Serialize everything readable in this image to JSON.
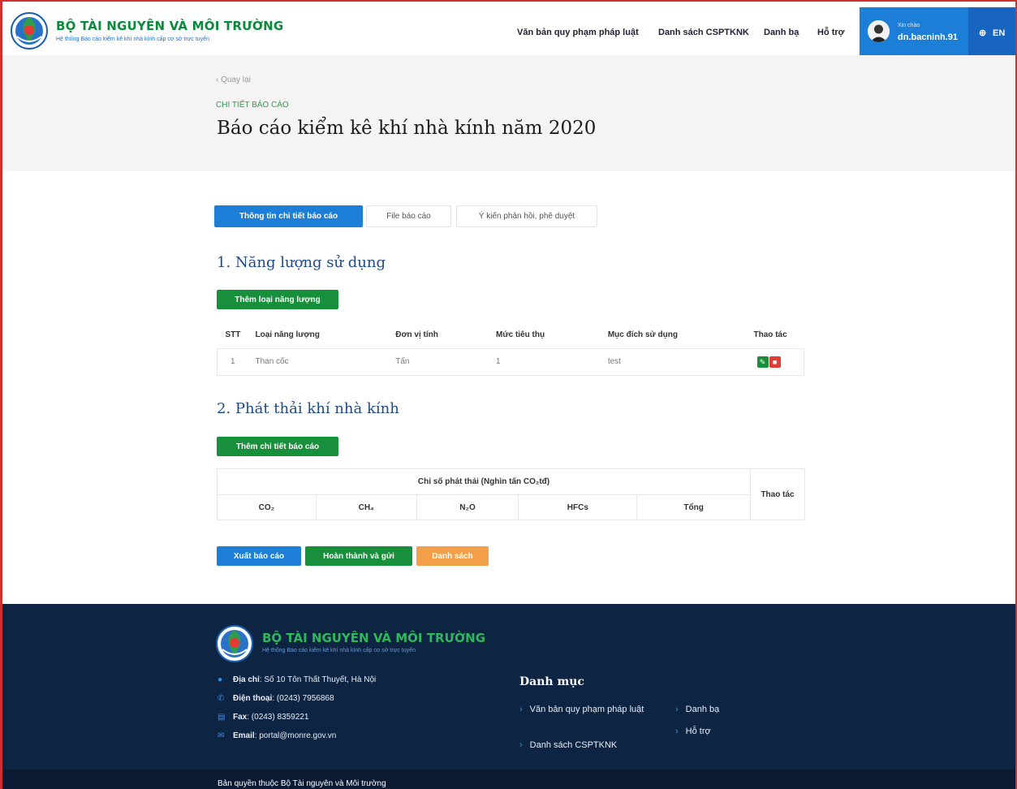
{
  "header": {
    "brand_title": "BỘ TÀI NGUYÊN VÀ MÔI TRƯỜNG",
    "brand_subtitle": "Hệ thống Báo cáo kiểm kê khí nhà kính cấp cơ sở trực tuyến",
    "nav": [
      "Văn bản quy phạm pháp luật",
      "Danh sách CSPTKNK",
      "Danh bạ",
      "Hỗ trợ"
    ],
    "greeting": "Xin chào",
    "username": "dn.bacninh.91",
    "language": "EN",
    "accent": "#1c7ed6"
  },
  "hero": {
    "back": "‹ Quay lại",
    "eyebrow": "CHI TIẾT BÁO CÁO",
    "title": "Báo cáo kiểm kê khí nhà kính năm 2020"
  },
  "tabs": [
    "Thông tin chi tiết báo cáo",
    "File báo cáo",
    "Ý kiến phản hồi, phê duyệt"
  ],
  "section1": {
    "title": "1. Năng lượng sử dụng",
    "add_button": "Thêm loại năng lượng",
    "columns": [
      "STT",
      "Loại năng lượng",
      "Đơn vị tính",
      "Mức tiêu thụ",
      "Mục đích sử dụng",
      "Thao tác"
    ],
    "rows": [
      {
        "stt": "1",
        "type": "Than cốc",
        "unit": "Tấn",
        "consumption": "1",
        "purpose": "test"
      }
    ]
  },
  "section2": {
    "title": "2. Phát thải khí nhà kính",
    "add_button": "Thêm chi tiết báo cáo",
    "group_header": "Chỉ số phát thải (Nghìn tấn CO₂tđ)",
    "action_header": "Thao tác",
    "columns": [
      "CO₂",
      "CH₄",
      "N₂O",
      "HFCs",
      "Tổng"
    ]
  },
  "actions": {
    "export": "Xuất báo cáo",
    "submit": "Hoàn thành và gửi",
    "list": "Danh sách"
  },
  "footer": {
    "brand_title": "BỘ TÀI NGUYÊN VÀ MÔI TRƯỜNG",
    "brand_subtitle": "Hệ thống Báo cáo kiểm kê khí nhà kính cấp cơ sở trực tuyến",
    "address_label": "Địa chỉ",
    "address": "Số 10 Tôn Thất Thuyết, Hà Nội",
    "phone_label": "Điện thoại",
    "phone": "(0243) 7956868",
    "fax_label": "Fax",
    "fax": "(0243) 8359221",
    "email_label": "Email",
    "email": "portal@monre.gov.vn",
    "menu_title": "Danh mục",
    "links": [
      "Văn bản quy phạm pháp luật",
      "Danh sách CSPTKNK",
      "Danh bạ",
      "Hỗ trợ"
    ],
    "copyright": "Bản quyền thuộc Bộ Tài nguyên và Môi trường"
  }
}
